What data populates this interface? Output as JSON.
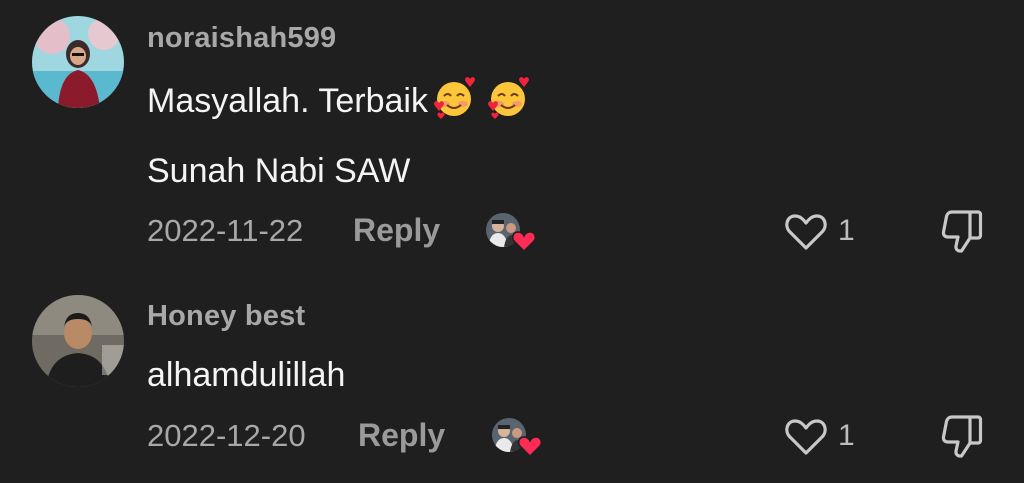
{
  "comments": [
    {
      "username": "noraishah599",
      "text_line1": "Masyallah. Terbaik",
      "emoji_names": [
        "smiling-face-with-hearts-emoji",
        "smiling-face-with-hearts-emoji"
      ],
      "text_line2": "Sunah Nabi SAW",
      "date": "2022-11-22",
      "reply_label": "Reply",
      "like_count": "1"
    },
    {
      "username": "Honey best",
      "text_line1": "alhamdulillah",
      "date": "2022-12-20",
      "reply_label": "Reply",
      "like_count": "1"
    }
  ],
  "colors": {
    "background": "#1f1f1f",
    "username": "#a8a8a8",
    "text": "#f4f4f4",
    "heart_badge": "#fe2c55"
  }
}
